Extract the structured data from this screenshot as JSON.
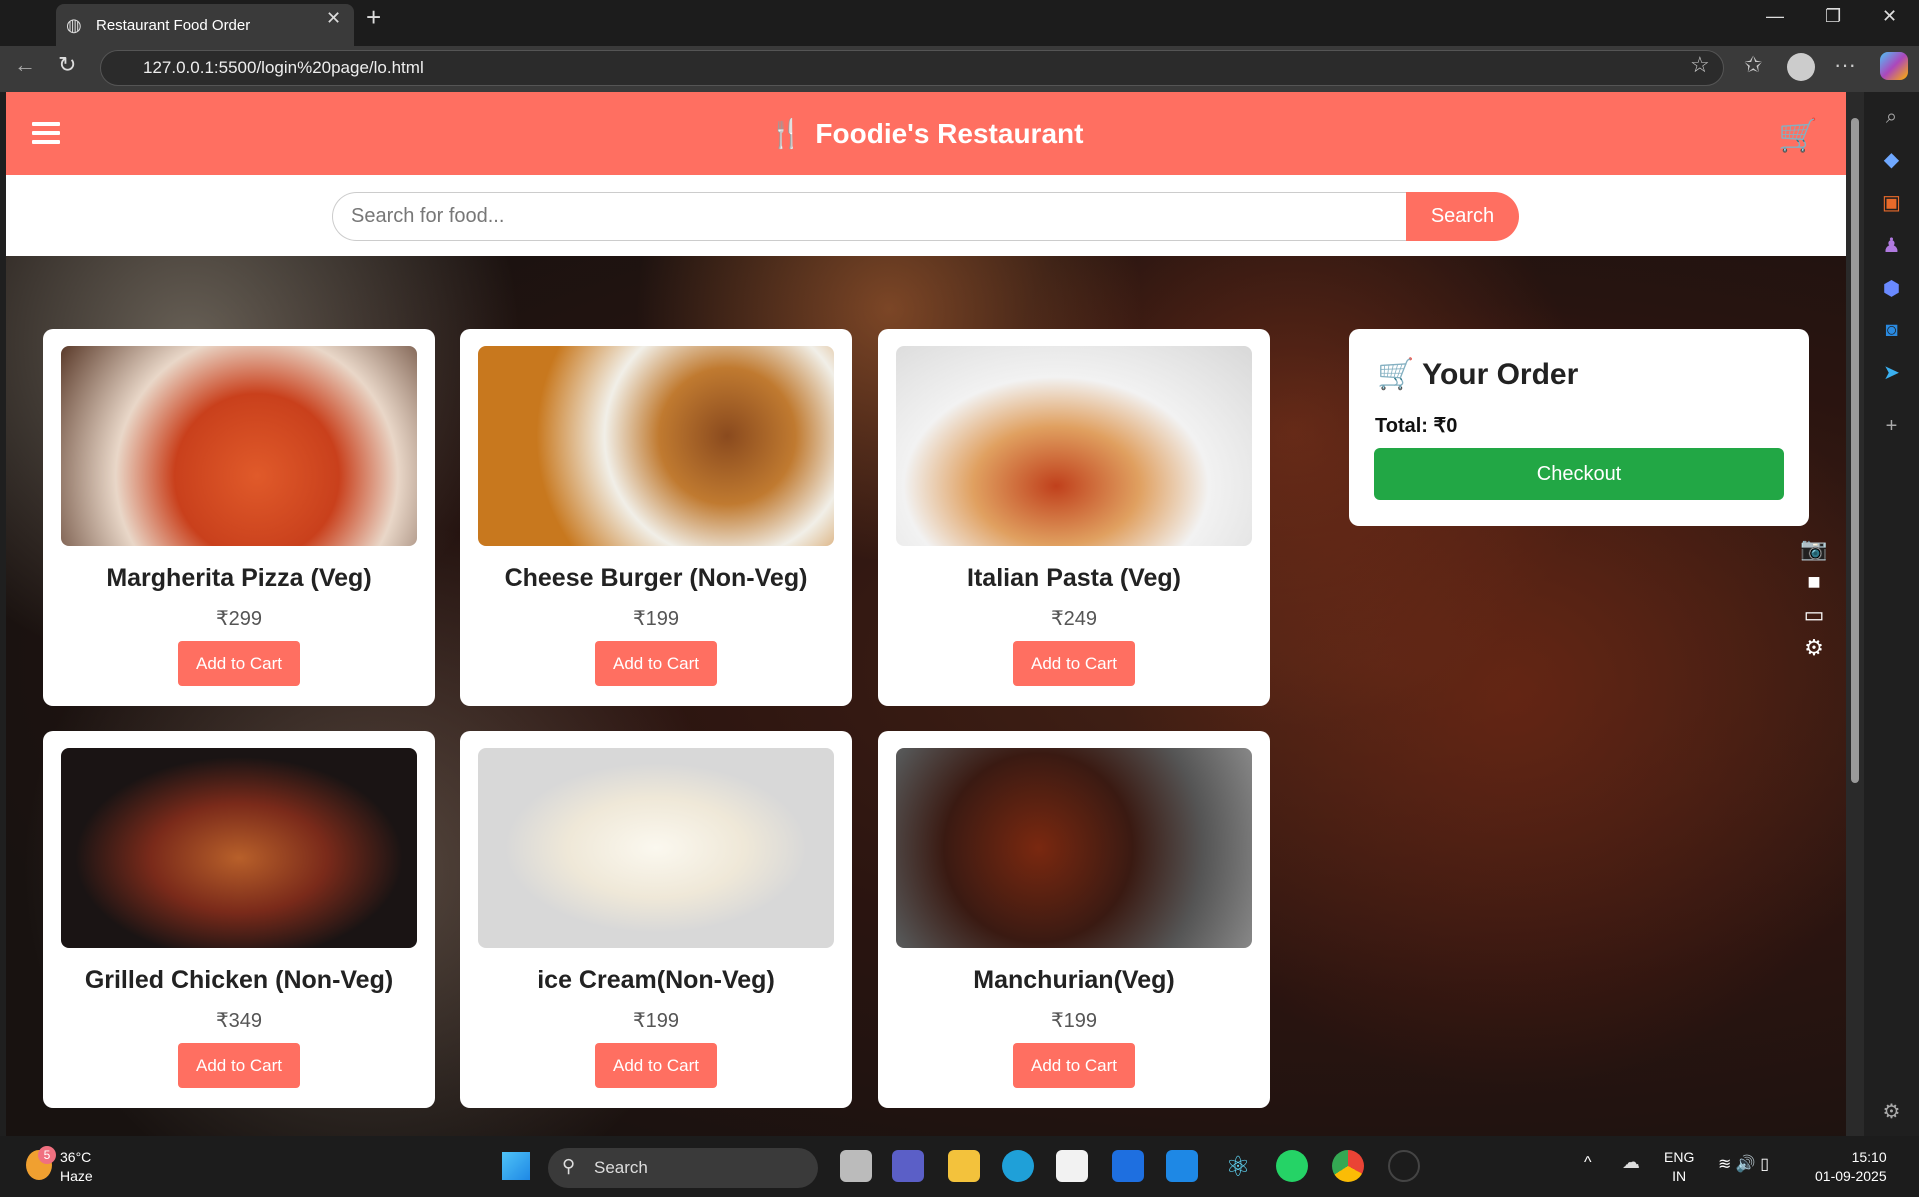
{
  "browser": {
    "tab_title": "Restaurant Food Order",
    "url": "127.0.0.1:5500/login%20page/lo.html"
  },
  "header": {
    "icon": "fork-knife-icon",
    "title": "Foodie's Restaurant",
    "cart_icon": "cart-icon"
  },
  "search": {
    "placeholder": "Search for food...",
    "button": "Search"
  },
  "menu": [
    {
      "name": "Margherita Pizza (Veg)",
      "price": "₹299",
      "button": "Add to Cart"
    },
    {
      "name": "Cheese Burger (Non-Veg)",
      "price": "₹199",
      "button": "Add to Cart"
    },
    {
      "name": "Italian Pasta (Veg)",
      "price": "₹249",
      "button": "Add to Cart"
    },
    {
      "name": "Grilled Chicken (Non-Veg)",
      "price": "₹349",
      "button": "Add to Cart"
    },
    {
      "name": "ice Cream(Non-Veg)",
      "price": "₹199",
      "button": "Add to Cart"
    },
    {
      "name": "Manchurian(Veg)",
      "price": "₹199",
      "button": "Add to Cart"
    }
  ],
  "order": {
    "title": "Your Order",
    "total": "Total: ₹0",
    "checkout": "Checkout"
  },
  "colors": {
    "brand": "#ff6f61",
    "checkout": "#22a745"
  },
  "taskbar": {
    "temp": "36°C",
    "weather": "Haze",
    "badge": "5",
    "search": "Search",
    "lang1": "ENG",
    "lang2": "IN",
    "time": "15:10",
    "date": "01-09-2025"
  }
}
